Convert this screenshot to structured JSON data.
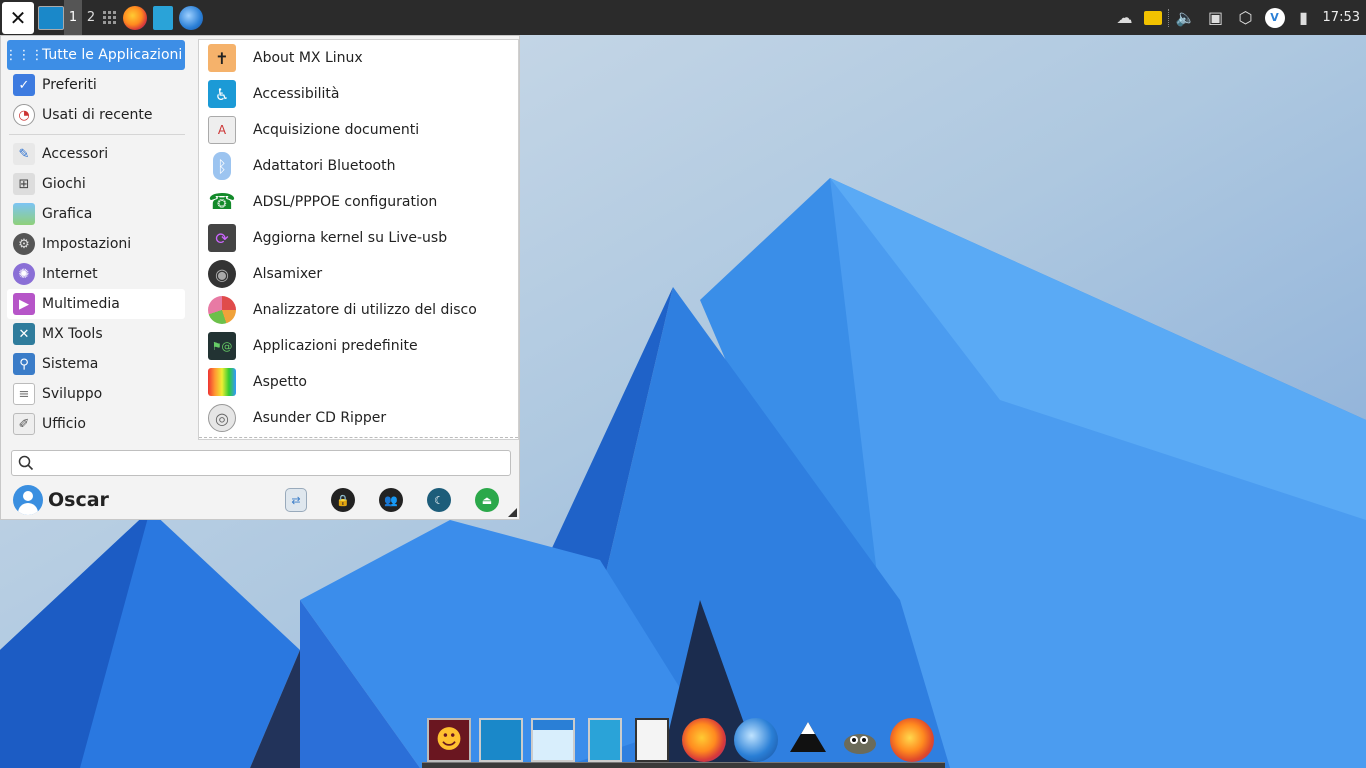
{
  "panel": {
    "workspaces": [
      "1",
      "2"
    ],
    "clock": "17:53"
  },
  "menu": {
    "categories": [
      {
        "label": "Tutte le Applicazioni",
        "icon": "grid-icon"
      },
      {
        "label": "Preferiti",
        "icon": "favorites-icon"
      },
      {
        "label": "Usati di recente",
        "icon": "clock-icon"
      },
      {
        "label": "Accessori",
        "icon": "accessories-icon"
      },
      {
        "label": "Giochi",
        "icon": "gamepad-icon"
      },
      {
        "label": "Grafica",
        "icon": "graphics-icon"
      },
      {
        "label": "Impostazioni",
        "icon": "settings-gear-icon"
      },
      {
        "label": "Internet",
        "icon": "internet-icon"
      },
      {
        "label": "Multimedia",
        "icon": "multimedia-icon"
      },
      {
        "label": "MX Tools",
        "icon": "mx-tools-icon"
      },
      {
        "label": "Sistema",
        "icon": "system-icon"
      },
      {
        "label": "Sviluppo",
        "icon": "development-icon"
      },
      {
        "label": "Ufficio",
        "icon": "office-icon"
      }
    ],
    "apps": [
      {
        "label": "About MX Linux",
        "icon": "mx-linux-icon"
      },
      {
        "label": "Accessibilità",
        "icon": "accessibility-icon"
      },
      {
        "label": "Acquisizione documenti",
        "icon": "scanner-icon"
      },
      {
        "label": "Adattatori Bluetooth",
        "icon": "bluetooth-icon"
      },
      {
        "label": "ADSL/PPPOE configuration",
        "icon": "phone-icon"
      },
      {
        "label": "Aggiorna kernel su Live-usb",
        "icon": "usb-update-icon"
      },
      {
        "label": "Alsamixer",
        "icon": "speaker-icon"
      },
      {
        "label": "Analizzatore di utilizzo del disco",
        "icon": "disk-usage-icon"
      },
      {
        "label": "Applicazioni predefinite",
        "icon": "default-apps-icon"
      },
      {
        "label": "Aspetto",
        "icon": "appearance-icon"
      },
      {
        "label": "Asunder CD Ripper",
        "icon": "cd-icon"
      }
    ],
    "search": {
      "placeholder": "",
      "value": ""
    },
    "user": {
      "name": "Oscar"
    }
  }
}
